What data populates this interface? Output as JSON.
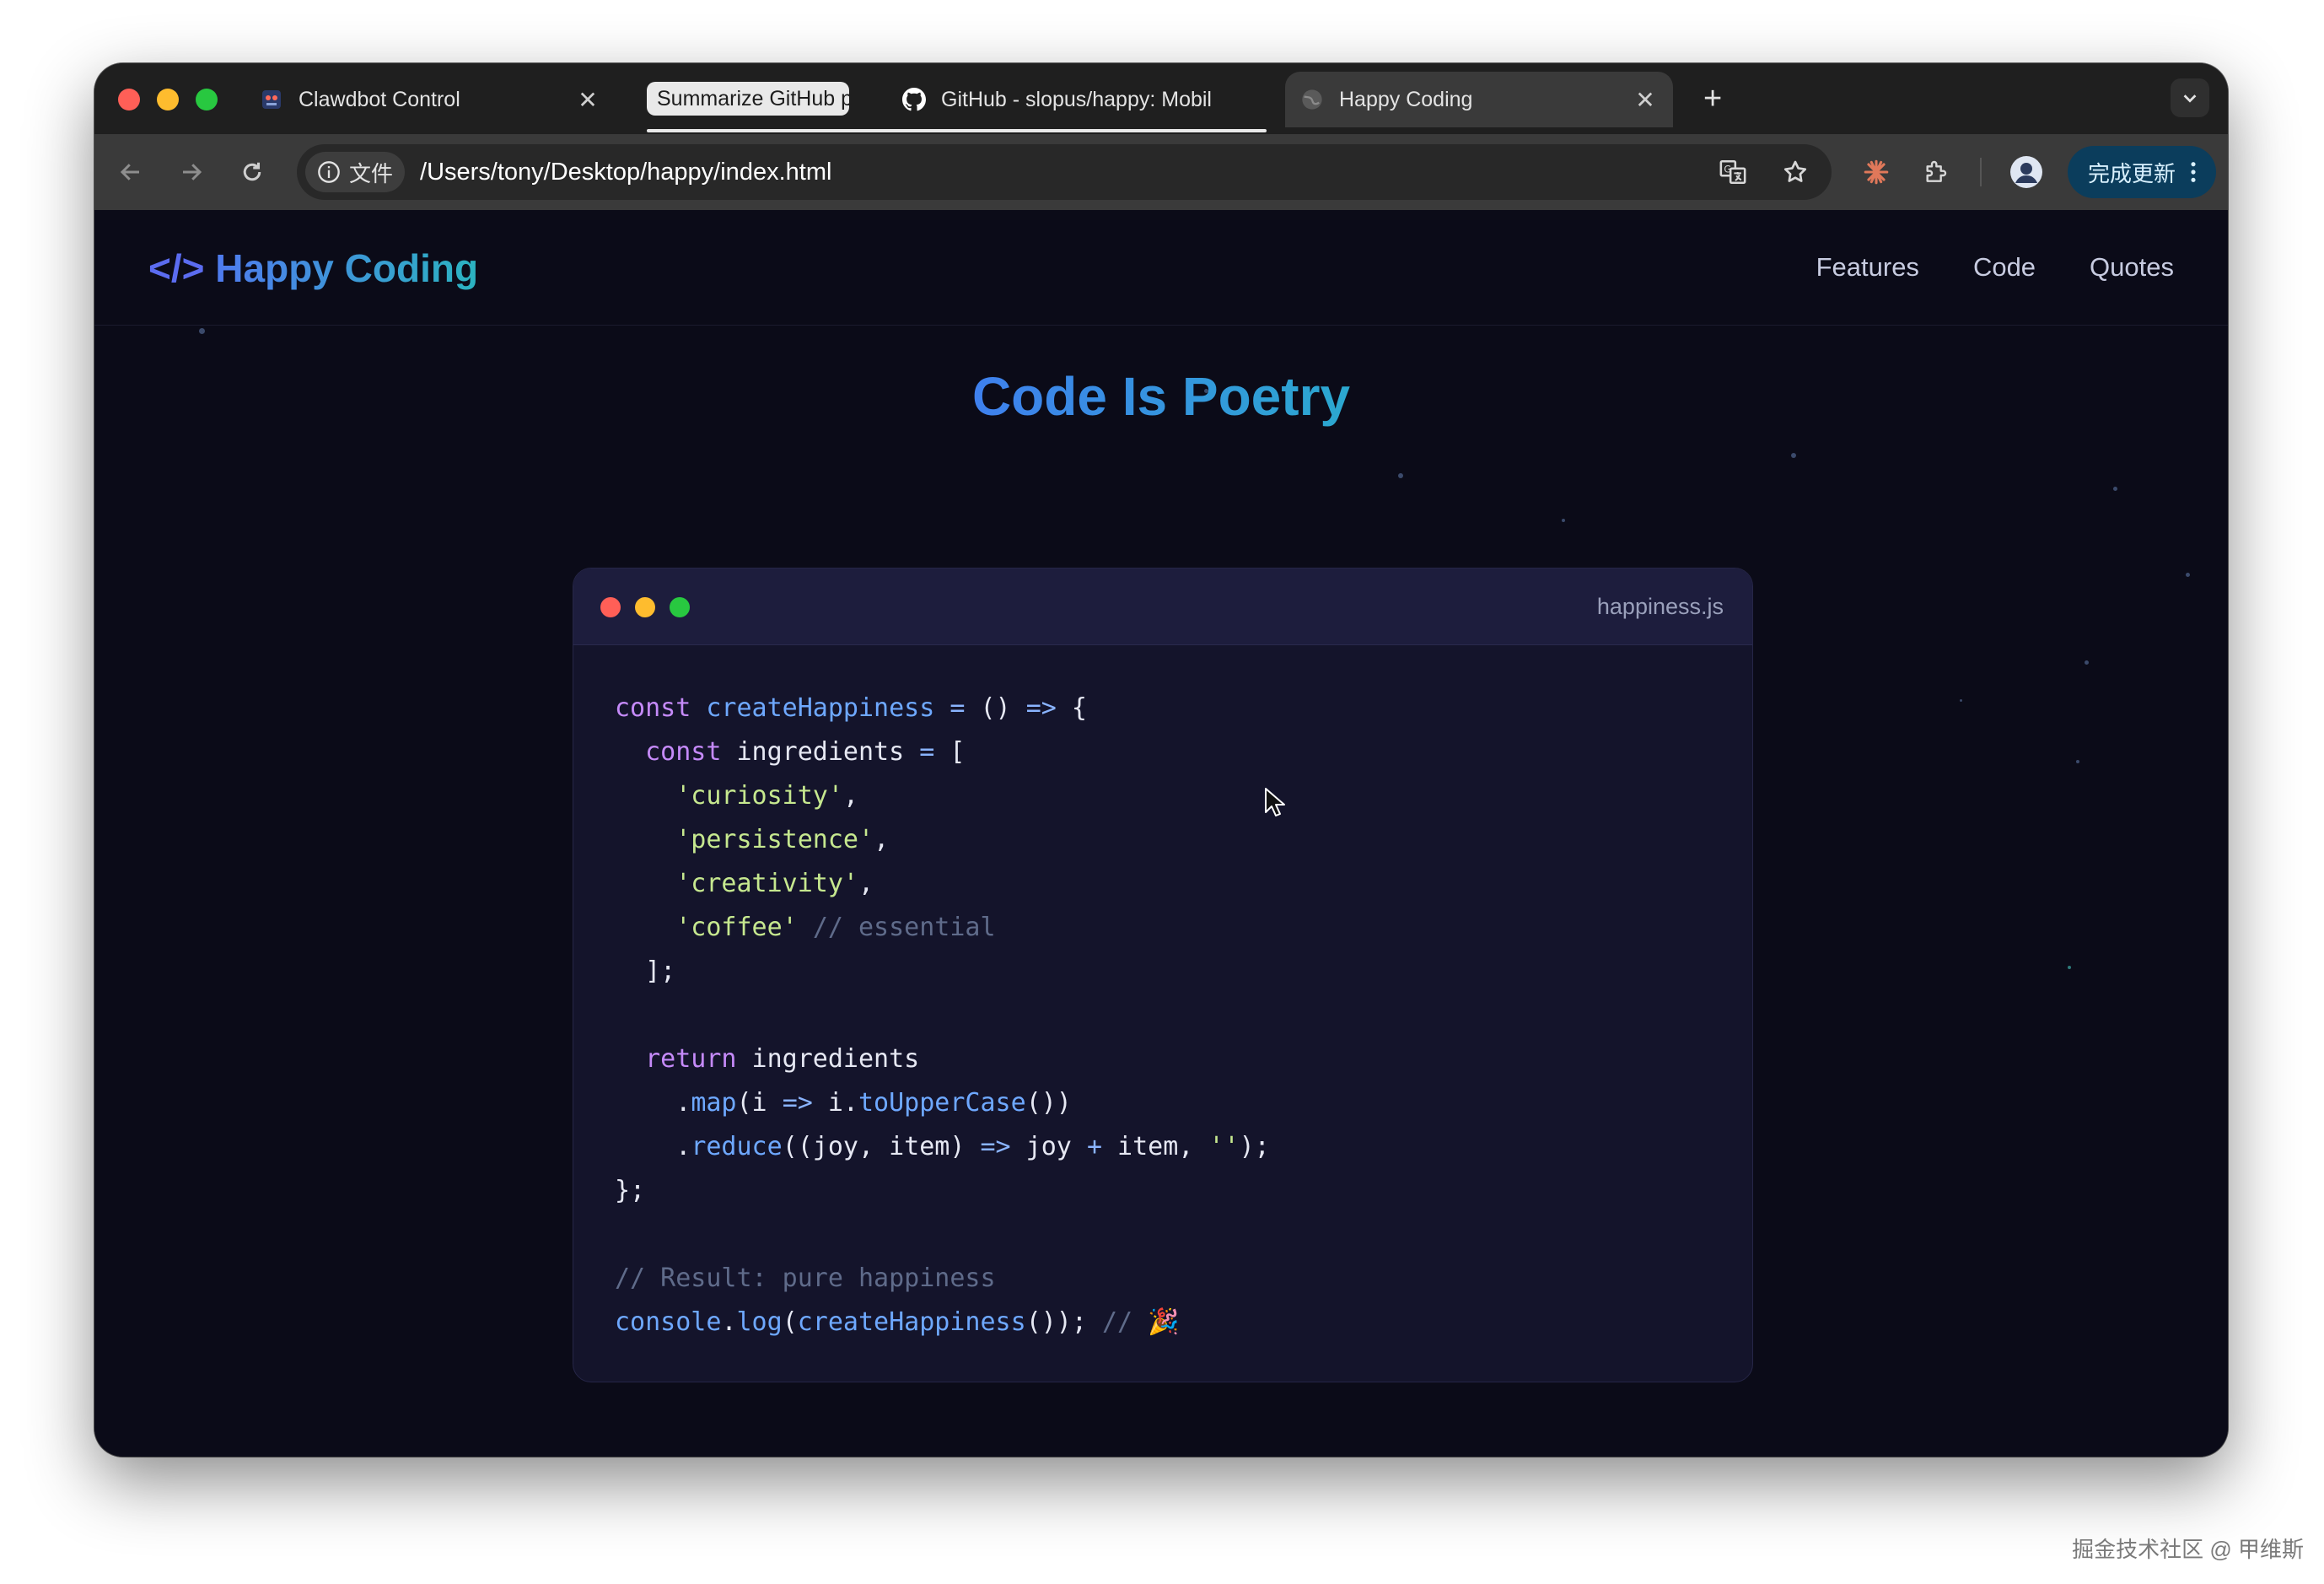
{
  "browser": {
    "tabs": [
      {
        "label": "Clawdbot Control",
        "icon": "clawdbot-favicon-icon"
      },
      {
        "label": "GitHub - slopus/happy: Mobil",
        "icon": "github-icon"
      },
      {
        "label": "Happy Coding",
        "icon": "globe-icon"
      }
    ],
    "tab_group_label": "Summarize GitHub p",
    "new_tab_label": "+",
    "address": {
      "info_chip_label": "文件",
      "url": "/Users/tony/Desktop/happy/index.html"
    },
    "update_button_label": "完成更新"
  },
  "site": {
    "logo_brackets": "</>",
    "logo_name": "Happy Coding",
    "nav": [
      "Features",
      "Code",
      "Quotes"
    ],
    "hero_title": "Code Is Poetry",
    "code_card": {
      "filename": "happiness.js",
      "lines": [
        [
          {
            "t": "const",
            "c": "kw"
          },
          {
            "t": " "
          },
          {
            "t": "createHappiness",
            "c": "fn"
          },
          {
            "t": " "
          },
          {
            "t": "=",
            "c": "op"
          },
          {
            "t": " () "
          },
          {
            "t": "=>",
            "c": "op"
          },
          {
            "t": " {"
          }
        ],
        [
          {
            "t": "  "
          },
          {
            "t": "const",
            "c": "kw"
          },
          {
            "t": " ingredients "
          },
          {
            "t": "=",
            "c": "op"
          },
          {
            "t": " ["
          }
        ],
        [
          {
            "t": "    "
          },
          {
            "t": "'curiosity'",
            "c": "str"
          },
          {
            "t": ","
          }
        ],
        [
          {
            "t": "    "
          },
          {
            "t": "'persistence'",
            "c": "str"
          },
          {
            "t": ","
          }
        ],
        [
          {
            "t": "    "
          },
          {
            "t": "'creativity'",
            "c": "str"
          },
          {
            "t": ","
          }
        ],
        [
          {
            "t": "    "
          },
          {
            "t": "'coffee'",
            "c": "str"
          },
          {
            "t": " "
          },
          {
            "t": "// essential",
            "c": "cm"
          }
        ],
        [
          {
            "t": "  ];"
          }
        ],
        [
          {
            "t": ""
          }
        ],
        [
          {
            "t": "  "
          },
          {
            "t": "return",
            "c": "kw"
          },
          {
            "t": " ingredients"
          }
        ],
        [
          {
            "t": "    ."
          },
          {
            "t": "map",
            "c": "fn"
          },
          {
            "t": "(i "
          },
          {
            "t": "=>",
            "c": "op"
          },
          {
            "t": " i."
          },
          {
            "t": "toUpperCase",
            "c": "fn"
          },
          {
            "t": "())"
          }
        ],
        [
          {
            "t": "    ."
          },
          {
            "t": "reduce",
            "c": "fn"
          },
          {
            "t": "((joy, item) "
          },
          {
            "t": "=>",
            "c": "op"
          },
          {
            "t": " joy "
          },
          {
            "t": "+",
            "c": "op"
          },
          {
            "t": " item, "
          },
          {
            "t": "''",
            "c": "str"
          },
          {
            "t": ");"
          }
        ],
        [
          {
            "t": "};"
          }
        ],
        [
          {
            "t": ""
          }
        ],
        [
          {
            "t": "// Result: pure happiness",
            "c": "cm"
          }
        ],
        [
          {
            "t": "console",
            "c": "fn"
          },
          {
            "t": "."
          },
          {
            "t": "log",
            "c": "fn"
          },
          {
            "t": "("
          },
          {
            "t": "createHappiness",
            "c": "fn"
          },
          {
            "t": "()); "
          },
          {
            "t": "// ",
            "c": "cm"
          },
          {
            "t": "🎉"
          }
        ]
      ]
    }
  },
  "watermark": "掘金技术社区 @ 甲维斯",
  "colors": {
    "page_bg": "#0b0b18",
    "card_bg": "#14142b",
    "keyword": "#c58af9",
    "function": "#6ea8ff",
    "string": "#c6e88f",
    "comment": "#5f6b8a",
    "accent": "#3f80ee",
    "update_button": "#0b3d5c"
  }
}
